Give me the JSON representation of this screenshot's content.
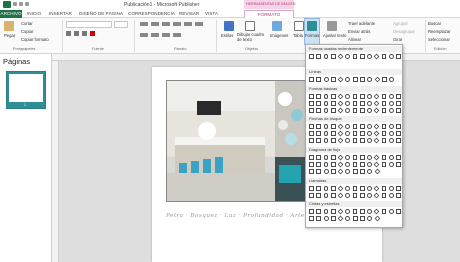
{
  "window": {
    "title": "Publicación1 - Microsoft Publisher",
    "tools_group": "HERRAMIENTAS DE IMAGEN"
  },
  "tabs": [
    {
      "label": "ARCHIVO"
    },
    {
      "label": "INICIO"
    },
    {
      "label": "INSERTAR"
    },
    {
      "label": "DISEÑO DE PÁGINA"
    },
    {
      "label": "CORRESPONDENCIA"
    },
    {
      "label": "REVISAR"
    },
    {
      "label": "VISTA"
    },
    {
      "label": "FORMATO"
    }
  ],
  "ribbon": {
    "paste": "Pegar",
    "cut": "Cortar",
    "copy": "Copiar",
    "copy_format": "Copiar formato",
    "styles": "Estilos",
    "draw_textbox": "Dibujar cuadro de texto",
    "images": "Imágenes",
    "table": "Tabla",
    "shapes": "Formas",
    "adjust": "Ajustar texto",
    "bring_forward": "Traer adelante",
    "send_back": "Enviar atrás",
    "align": "Alinear",
    "group": "Agrupar",
    "ungroup": "Desagrupar",
    "rotate": "Girar",
    "find": "Buscar",
    "replace": "Reemplazar",
    "select": "Seleccionar",
    "groups": {
      "clipboard": "Portapapeles",
      "font": "Fuente",
      "paragraph": "Párrafo",
      "objects": "Objetos",
      "edit": "Edición"
    }
  },
  "pages_pane": {
    "title": "Páginas",
    "page_number": "1"
  },
  "gallery": {
    "sections": [
      "Formas usadas recientemente",
      "Líneas",
      "Formas básicas",
      "Flechas de bloque",
      "Diagrama de flujo",
      "Llamadas",
      "Cintas y estrellas"
    ]
  },
  "document": {
    "caption": "Petra · Bosquez · Luz · Profundidad · Arte"
  },
  "colors": {
    "accent": "#217346",
    "tools": "#b23c7a",
    "thumb": "#2f8f96"
  }
}
